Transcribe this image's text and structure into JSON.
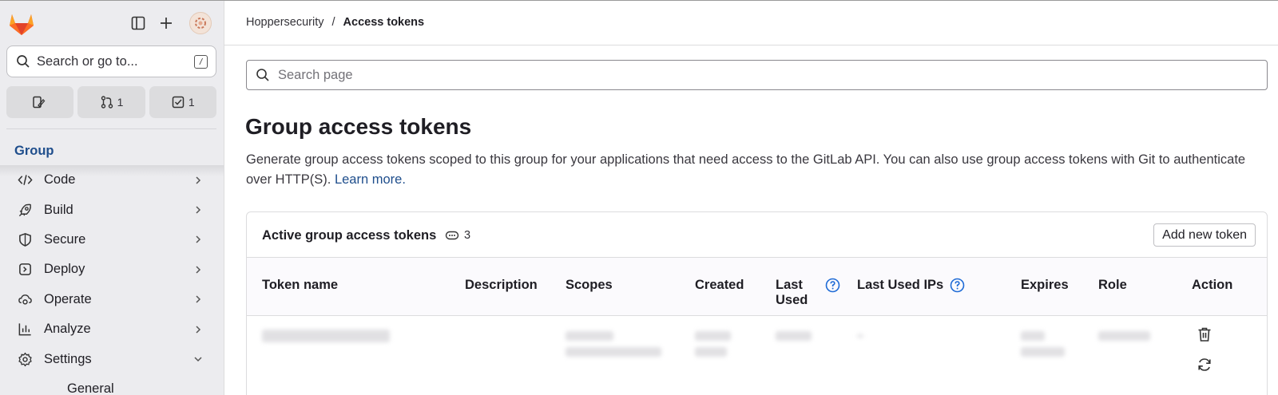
{
  "sidebar": {
    "search_placeholder": "Search or go to...",
    "shortcut_key": "/",
    "counters": [
      {
        "icon": "issues-icon",
        "count": ""
      },
      {
        "icon": "merge-request-icon",
        "count": "1"
      },
      {
        "icon": "todo-icon",
        "count": "1"
      }
    ],
    "context_label": "Group",
    "nav": [
      {
        "label": "Code",
        "icon": "code-icon",
        "expanded": false
      },
      {
        "label": "Build",
        "icon": "rocket-icon",
        "expanded": false
      },
      {
        "label": "Secure",
        "icon": "shield-icon",
        "expanded": false
      },
      {
        "label": "Deploy",
        "icon": "deploy-icon",
        "expanded": false
      },
      {
        "label": "Operate",
        "icon": "cloud-gear-icon",
        "expanded": false
      },
      {
        "label": "Analyze",
        "icon": "chart-icon",
        "expanded": false
      },
      {
        "label": "Settings",
        "icon": "gear-icon",
        "expanded": true
      }
    ],
    "sub_nav": [
      "General"
    ]
  },
  "breadcrumb": {
    "group": "Hoppersecurity",
    "separator": "/",
    "current": "Access tokens"
  },
  "page_search": {
    "placeholder": "Search page"
  },
  "page": {
    "title": "Group access tokens",
    "description": "Generate group access tokens scoped to this group for your applications that need access to the GitLab API. You can also use group access tokens with Git to authenticate over HTTP(S).",
    "learn_more": "Learn more."
  },
  "tokens_card": {
    "title": "Active group access tokens",
    "count": "3",
    "add_button": "Add new token",
    "columns": {
      "name": "Token name",
      "description": "Description",
      "scopes": "Scopes",
      "created": "Created",
      "last_used_1": "Last",
      "last_used_2": "Used",
      "last_used_ips": "Last Used IPs",
      "expires": "Expires",
      "role": "Role",
      "action": "Action"
    }
  },
  "colors": {
    "sidebar_bg": "#ececef",
    "link": "#1f4e8c",
    "text": "#1f1e24"
  }
}
